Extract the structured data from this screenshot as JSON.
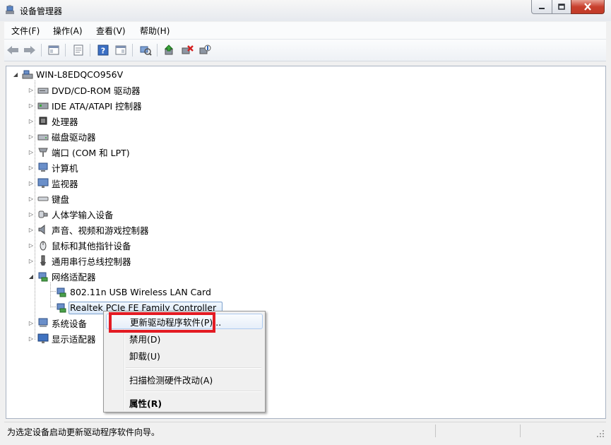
{
  "window": {
    "title": "设备管理器"
  },
  "menubar": {
    "items": [
      "文件(F)",
      "操作(A)",
      "查看(V)",
      "帮助(H)"
    ]
  },
  "toolbar": {
    "icons": [
      "back-arrow-icon",
      "forward-arrow-icon",
      "show-hide-console-tree-icon",
      "properties-icon",
      "help-icon",
      "show-action-pane-icon",
      "scan-hardware-icon",
      "update-driver-icon",
      "uninstall-device-icon",
      "disable-device-icon"
    ]
  },
  "tree": {
    "root": "WIN-L8EDQCO956V",
    "categories": [
      "DVD/CD-ROM 驱动器",
      "IDE ATA/ATAPI 控制器",
      "处理器",
      "磁盘驱动器",
      "端口 (COM 和 LPT)",
      "计算机",
      "监视器",
      "键盘",
      "人体学输入设备",
      "声音、视频和游戏控制器",
      "鼠标和其他指针设备",
      "通用串行总线控制器",
      "网络适配器",
      "系统设备",
      "显示适配器"
    ],
    "network_children": [
      "802.11n USB Wireless LAN Card",
      "Realtek PCIe FE Family Controller"
    ]
  },
  "context_menu": {
    "items": [
      "更新驱动程序软件(P)...",
      "禁用(D)",
      "卸载(U)",
      "扫描检测硬件改动(A)",
      "属性(R)"
    ]
  },
  "statusbar": {
    "text": "为选定设备启动更新驱动程序软件向导。"
  },
  "colors": {
    "highlight_box": "#e31b23",
    "selection": "#d9e8f8",
    "close_button": "#c8402e"
  }
}
